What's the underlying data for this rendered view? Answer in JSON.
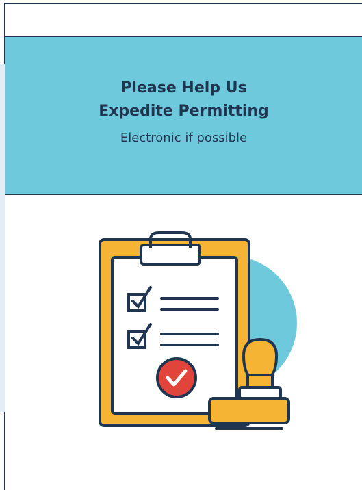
{
  "banner": {
    "title_line1": "Please Help Us",
    "title_line2": "Expedite Permitting",
    "subtitle": "Electronic if possible"
  },
  "colors": {
    "banner_bg": "#6ec9dc",
    "navy": "#1f3550",
    "clipboard_orange": "#f6b434",
    "badge_red": "#e0443a"
  },
  "icons": [
    "clipboard-checklist-icon",
    "approval-stamp-icon",
    "checkmark-badge-icon"
  ]
}
